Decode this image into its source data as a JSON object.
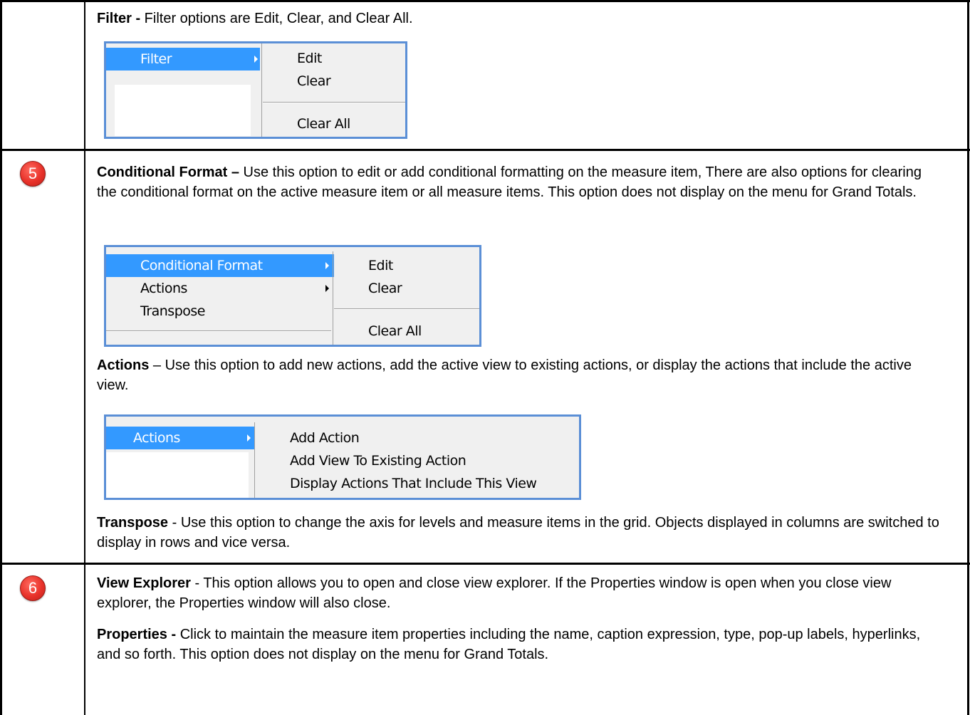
{
  "rows": [
    {
      "badge": "",
      "filter": {
        "title": "Filter - ",
        "text": "Filter options are Edit, Clear, and Clear All.",
        "menu": {
          "highlighted": "Filter",
          "sub": [
            "Edit",
            "Clear",
            "Clear All"
          ]
        }
      }
    },
    {
      "badge": "5",
      "conditional": {
        "title": "Conditional Format –",
        "text": " Use this option to edit or add conditional formatting on the measure item, There are also options for clearing the conditional format on the active measure item or all measure items. This option does not display on the menu for Grand Totals.",
        "menu": {
          "items": [
            "Conditional Format",
            "Actions",
            "Transpose"
          ],
          "sub": [
            "Edit",
            "Clear",
            "Clear All"
          ]
        }
      },
      "actions": {
        "title": "Actions",
        "text": " – Use this option to add new actions, add the active view to existing actions, or display the actions that include the active view.",
        "menu": {
          "highlighted": "Actions",
          "sub": [
            "Add Action",
            "Add View To Existing Action",
            "Display Actions That Include This View"
          ]
        }
      },
      "transpose": {
        "title": "Transpose",
        "text": " - Use this option to change the axis for levels and measure items in the grid. Objects displayed in columns are switched to display in rows and vice versa."
      }
    },
    {
      "badge": "6",
      "view_explorer": {
        "title": "View Explorer",
        "text": " - This option allows you to open and close view explorer. If the Properties window is open when you close view explorer, the Properties window will also close."
      },
      "properties": {
        "title": "Properties - ",
        "text": "Click to maintain the measure item properties including the name, caption expression, type, pop-up labels, hyperlinks, and so forth. This option does not display on the menu for Grand Totals."
      }
    }
  ],
  "colors": {
    "menu_border": "#5b8fd6",
    "menu_highlight": "#3399ff",
    "badge": "#e8322a"
  }
}
